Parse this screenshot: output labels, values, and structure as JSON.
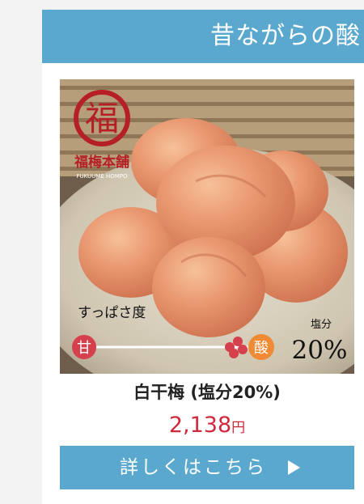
{
  "banner": {
    "title": "昔ながらの酸"
  },
  "product": {
    "brand_seal": "福",
    "brand_name": "福梅本舗",
    "brand_romaji": "FUKUUME HOMPO",
    "sourness_label": "すっぱさ度",
    "sweet_label": "甘",
    "sour_label": "酸",
    "salt_label": "塩分",
    "salt_value": "20%",
    "name": "白干梅 (塩分20%)",
    "price": "2,138",
    "price_unit": "円"
  },
  "button": {
    "label": "詳しくはこちら",
    "icon": "play-icon"
  },
  "colors": {
    "accent": "#5ba8cf",
    "price": "#d0283d",
    "seal": "#b51f25"
  }
}
